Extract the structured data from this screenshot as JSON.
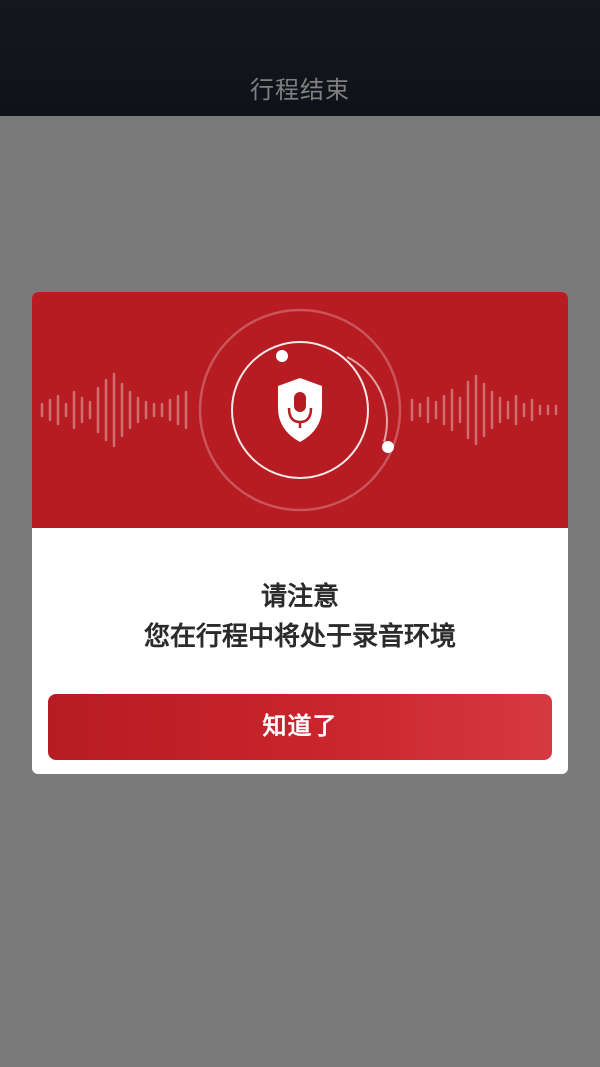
{
  "header": {
    "title": "行程结束"
  },
  "dialog": {
    "title": "请注意",
    "message": "您在行程中将处于录音环境",
    "confirm_label": "知道了",
    "icon": "microphone-shield-icon"
  },
  "colors": {
    "header_bg": "#1f2431",
    "accent": "#b71c23",
    "overlay": "#808080",
    "text": "#2b2b2b"
  }
}
